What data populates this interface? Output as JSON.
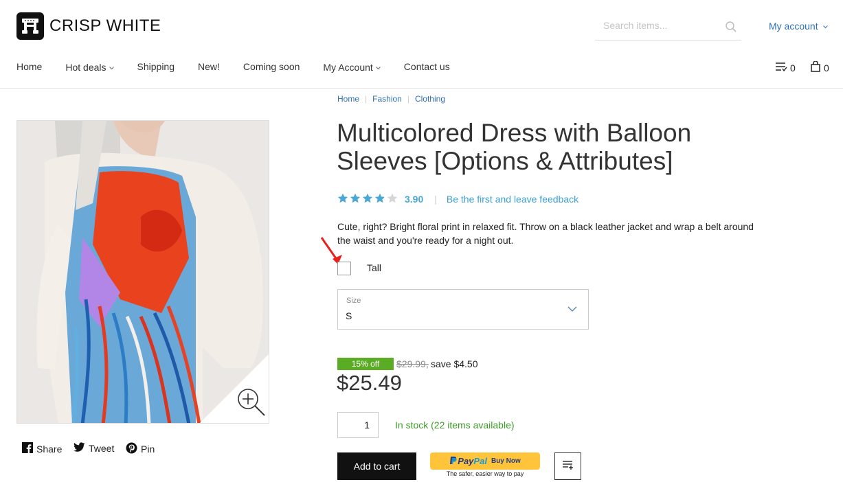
{
  "brand": {
    "name": "CRISP WHITE"
  },
  "search": {
    "placeholder": "Search items..."
  },
  "account": {
    "label": "My account"
  },
  "nav": {
    "items": [
      {
        "label": "Home",
        "dropdown": false
      },
      {
        "label": "Hot deals",
        "dropdown": true
      },
      {
        "label": "Shipping",
        "dropdown": false
      },
      {
        "label": "New!",
        "dropdown": false
      },
      {
        "label": "Coming soon",
        "dropdown": false
      },
      {
        "label": "My Account",
        "dropdown": true
      },
      {
        "label": "Contact us",
        "dropdown": false
      }
    ]
  },
  "counters": {
    "wishlist": "0",
    "cart": "0"
  },
  "breadcrumb": [
    "Home",
    "Fashion",
    "Clothing"
  ],
  "product": {
    "title": "Multicolored Dress with Balloon Sleeves [Options & Attributes]",
    "rating_value": "3.90",
    "rating_stars": 3.9,
    "feedback_link": "Be the first and leave feedback",
    "description": "Cute, right? Bright floral print in relaxed fit. Throw on a black leather jacket and wrap a belt around the waist  and you're ready for a night out.",
    "option_checkbox_label": "Tall",
    "option_checkbox_checked": false,
    "size_label": "Size",
    "size_value": "S",
    "discount_badge": "15% off",
    "old_price": "$29.99,",
    "save_text": "save $4.50",
    "price": "$25.49",
    "quantity": "1",
    "stock": "In stock (22 items available)"
  },
  "share": {
    "facebook": "Share",
    "twitter": "Tweet",
    "pinterest": "Pin"
  },
  "actions": {
    "add_to_cart": "Add to cart",
    "paypal_p": "Pay",
    "paypal_pal": "Pal",
    "paypal_buy": "Buy Now",
    "paypal_sub": "The safer, easier way to pay"
  },
  "colors": {
    "link": "#2f6fb3",
    "rating": "#49a8d8",
    "badge": "#5aac24",
    "stock": "#3f9b2a",
    "paypal": "#ffc439"
  }
}
